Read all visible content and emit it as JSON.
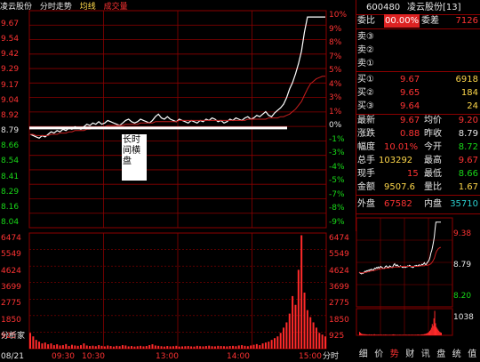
{
  "main_header": {
    "stock_name": "凌云股份",
    "chart_title": "分时走势",
    "avg_label": "均线",
    "vol_label": "成交量"
  },
  "price_axis_left": [
    "9.67",
    "9.54",
    "9.42",
    "9.29",
    "9.17",
    "9.04",
    "8.92",
    "8.79",
    "8.66",
    "8.54",
    "8.41",
    "8.29",
    "8.16",
    "8.04"
  ],
  "price_axis_right": [
    "10%",
    "9%",
    "8%",
    "7%",
    "5%",
    "4%",
    "3%",
    "1%",
    "0%",
    "-1%",
    "-3%",
    "-4%",
    "-5%",
    "-7%",
    "-8%",
    "-9%"
  ],
  "volume_axis_left": [
    "6474",
    "5549",
    "4624",
    "3699",
    "2775",
    "1850",
    "925"
  ],
  "volume_axis_right": [
    "6474",
    "5549",
    "4624",
    "3699",
    "2775",
    "1850",
    "925"
  ],
  "time_labels": [
    "08/21",
    "09:30",
    "10:30",
    "13:00",
    "14:00",
    "15:00"
  ],
  "bottom_corner_label": "分析家",
  "bottom_right_label": "分时",
  "annotation": "长时间横盘",
  "quote": {
    "code": "600480",
    "name": "凌云股份[13]",
    "weibi_label": "委比",
    "weibi_value": "00.00%",
    "weicha_label": "委差",
    "weicha_value": "7126",
    "sell3": "卖③",
    "sell2": "卖②",
    "sell1": "卖①",
    "buy1_label": "买①",
    "buy1_price": "9.67",
    "buy1_vol": "6918",
    "buy2_label": "买②",
    "buy2_price": "9.65",
    "buy2_vol": "184",
    "buy3_label": "买③",
    "buy3_price": "9.64",
    "buy3_vol": "24",
    "latest_label": "最新",
    "latest_value": "9.67",
    "avg_label": "均价",
    "avg_value": "9.20",
    "change_label": "涨跌",
    "change_value": "0.88",
    "prev_close_label": "昨收",
    "prev_close_value": "8.79",
    "amplitude_label": "幅度",
    "amplitude_value": "10.01%",
    "open_label": "今开",
    "open_value": "8.72",
    "total_vol_label": "总手",
    "total_vol_value": "103292",
    "high_label": "最高",
    "high_value": "9.67",
    "cur_vol_label": "现手",
    "cur_vol_value": "15",
    "low_label": "最低",
    "low_value": "8.66",
    "amount_label": "金额",
    "amount_value": "9507.6",
    "vol_ratio_label": "量比",
    "vol_ratio_value": "1.67",
    "outer_label": "外盘",
    "outer_value": "67582",
    "inner_label": "内盘",
    "inner_value": "35710"
  },
  "mini_chart": {
    "axis": [
      "9.38",
      "8.79",
      "8.20",
      "1038"
    ]
  },
  "tabs": [
    "细",
    "价",
    "势",
    "财",
    "讯",
    "盘",
    "统",
    "值"
  ],
  "active_tab": 2,
  "colors": {
    "up": "#ff3333",
    "down": "#18d818",
    "grid": "#8b0000",
    "price_line": "#ffffff",
    "avg_line": "#c81e1e",
    "volume": "#ff2a2a"
  },
  "chart_data": {
    "type": "line",
    "series": [
      {
        "values": [
          8.74,
          8.73,
          8.72,
          8.71,
          8.73,
          8.72,
          8.74,
          8.76,
          8.75,
          8.77,
          8.76,
          8.78,
          8.77,
          8.79,
          8.78,
          8.8,
          8.79,
          8.78,
          8.8,
          8.82,
          8.81,
          8.83,
          8.82,
          8.84,
          8.82,
          8.83,
          8.85,
          8.84,
          8.83,
          8.82,
          8.81,
          8.83,
          8.85,
          8.86,
          8.84,
          8.83,
          8.84,
          8.86,
          8.85,
          8.84,
          8.83,
          8.85,
          8.88,
          8.9,
          8.87,
          8.86,
          8.88,
          8.86,
          8.85,
          8.84,
          8.86,
          8.85,
          8.84,
          8.83,
          8.85,
          8.84,
          8.83,
          8.85,
          8.84,
          8.86,
          8.85,
          8.87,
          8.86,
          8.84,
          8.85,
          8.83,
          8.84,
          8.86,
          8.85,
          8.87,
          8.86,
          8.85,
          8.87,
          8.88,
          8.86,
          8.87,
          8.89,
          8.88,
          8.9,
          8.92,
          8.89,
          8.88,
          8.91,
          8.93,
          8.95,
          8.98,
          9.03,
          9.1,
          9.15,
          9.22,
          9.3,
          9.4,
          9.55,
          9.67,
          9.67,
          9.67,
          9.67,
          9.67,
          9.67,
          9.67
        ]
      },
      {
        "values": [
          8.74,
          8.74,
          8.73,
          8.73,
          8.73,
          8.73,
          8.73,
          8.74,
          8.74,
          8.74,
          8.75,
          8.75,
          8.75,
          8.76,
          8.76,
          8.77,
          8.77,
          8.77,
          8.77,
          8.78,
          8.78,
          8.79,
          8.79,
          8.8,
          8.8,
          8.8,
          8.81,
          8.81,
          8.81,
          8.81,
          8.81,
          8.81,
          8.82,
          8.82,
          8.82,
          8.82,
          8.82,
          8.83,
          8.83,
          8.83,
          8.83,
          8.83,
          8.84,
          8.84,
          8.84,
          8.84,
          8.84,
          8.84,
          8.84,
          8.84,
          8.85,
          8.85,
          8.85,
          8.85,
          8.85,
          8.85,
          8.85,
          8.85,
          8.85,
          8.85,
          8.85,
          8.85,
          8.85,
          8.85,
          8.85,
          8.85,
          8.85,
          8.85,
          8.85,
          8.85,
          8.85,
          8.85,
          8.85,
          8.86,
          8.86,
          8.86,
          8.86,
          8.86,
          8.86,
          8.86,
          8.87,
          8.87,
          8.87,
          8.87,
          8.88,
          8.88,
          8.89,
          8.9,
          8.92,
          8.94,
          8.97,
          9.0,
          9.05,
          9.1,
          9.14,
          9.16,
          9.18,
          9.19,
          9.2,
          9.2
        ]
      }
    ],
    "hline": 8.79,
    "ylim": [
      8.0,
      9.72
    ],
    "volume": [
      900,
      700,
      500,
      400,
      300,
      350,
      250,
      300,
      200,
      250,
      180,
      200,
      260,
      150,
      220,
      180,
      160,
      200,
      300,
      180,
      150,
      170,
      140,
      200,
      160,
      130,
      180,
      150,
      120,
      160,
      140,
      200,
      180,
      130,
      150,
      120,
      140,
      160,
      130,
      150,
      200,
      250,
      180,
      160,
      140,
      120,
      150,
      130,
      140,
      160,
      120,
      130,
      140,
      150,
      130,
      120,
      160,
      140,
      130,
      150,
      170,
      140,
      130,
      160,
      150,
      140,
      130,
      150,
      160,
      140,
      180,
      200,
      160,
      140,
      180,
      220,
      260,
      200,
      300,
      350,
      400,
      500,
      600,
      700,
      900,
      1200,
      1500,
      2000,
      3000,
      2500,
      4500,
      6474,
      3200,
      2200,
      1800,
      1500,
      1200,
      900,
      800,
      700
    ],
    "vol_ylim": [
      0,
      6600
    ]
  }
}
